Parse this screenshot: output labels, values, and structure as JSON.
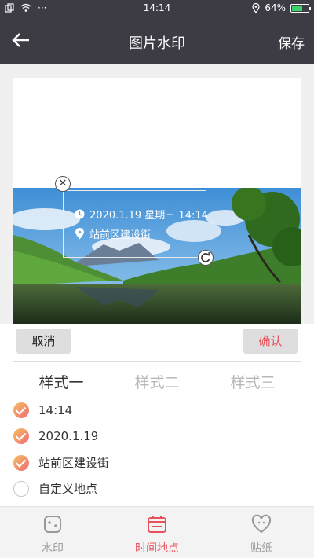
{
  "status_bar": {
    "time": "14:14",
    "battery": "64%",
    "battery_level": 0.64
  },
  "header": {
    "back_icon": "arrow-left-icon",
    "title": "图片水印",
    "save_label": "保存"
  },
  "watermark": {
    "date_time": "2020.1.19 星期三 14:14",
    "location": "站前区建设街"
  },
  "actions": {
    "cancel_label": "取消",
    "confirm_label": "确认"
  },
  "style_tabs": [
    "样式一",
    "样式二",
    "样式三"
  ],
  "options": [
    {
      "label": "14:14",
      "checked": true
    },
    {
      "label": "2020.1.19",
      "checked": true
    },
    {
      "label": "站前区建设街",
      "checked": true
    },
    {
      "label": "自定义地点",
      "checked": false
    }
  ],
  "bottom_nav": [
    {
      "label": "水印",
      "icon": "watermark-icon",
      "active": false
    },
    {
      "label": "时间地点",
      "icon": "calendar-icon",
      "active": true
    },
    {
      "label": "贴纸",
      "icon": "heart-sticker-icon",
      "active": false
    }
  ],
  "colors": {
    "header_bg": "#3d3b44",
    "accent": "#e8505b",
    "check_gradient_start": "#f6bf5e",
    "check_gradient_end": "#ef6b78"
  }
}
